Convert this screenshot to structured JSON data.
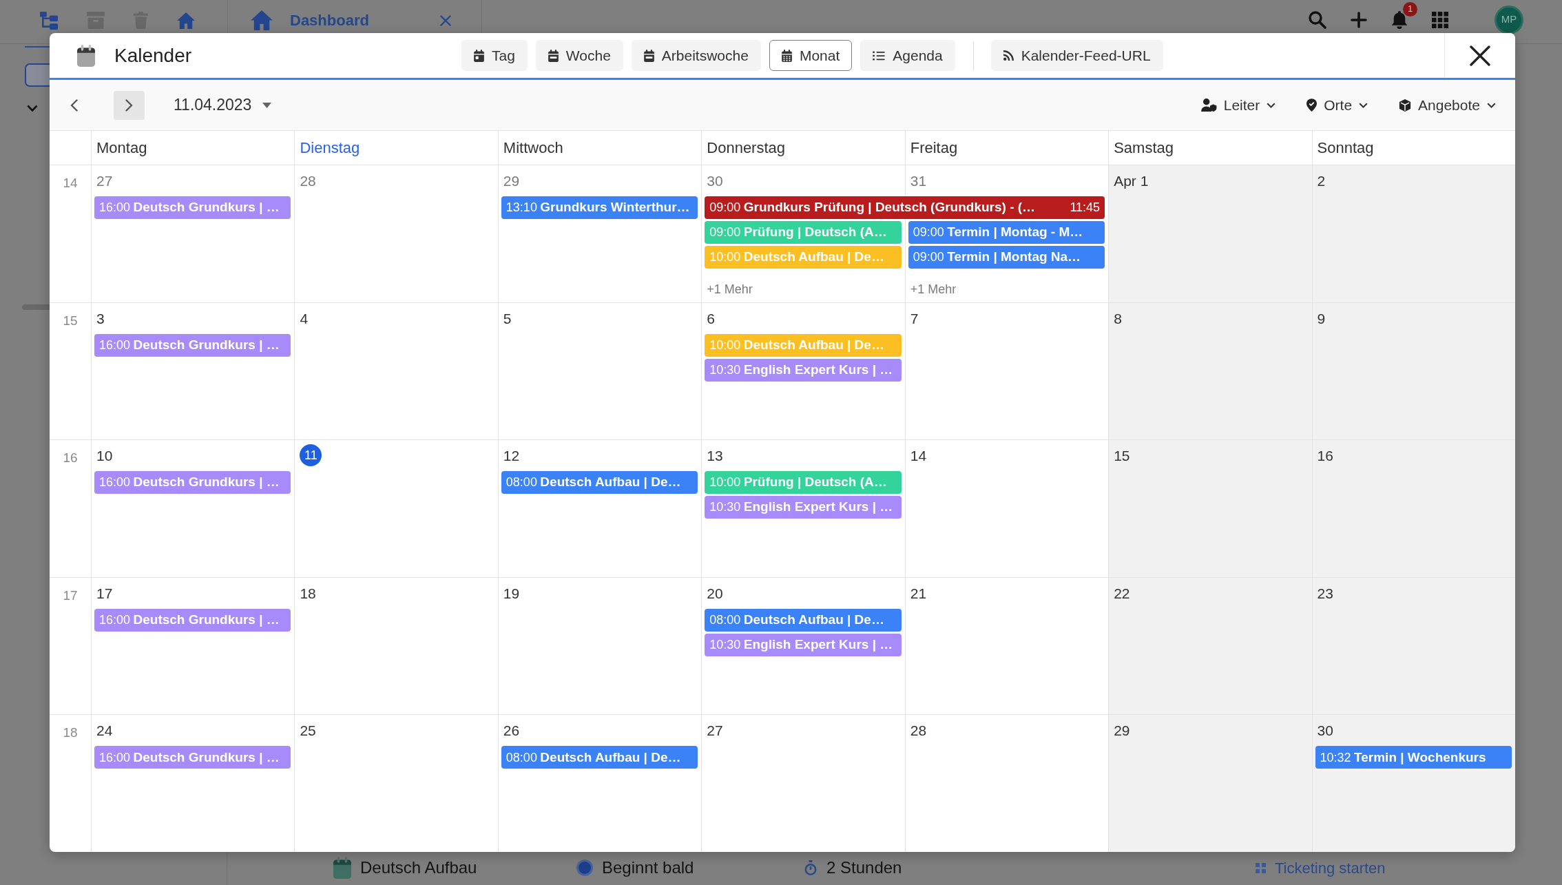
{
  "app": {
    "toolbar": [
      {
        "kind": "hierarchy",
        "disabled": false
      },
      {
        "kind": "archive",
        "disabled": true
      },
      {
        "kind": "trash",
        "disabled": true
      },
      {
        "kind": "home",
        "disabled": false
      }
    ],
    "tab": {
      "label": "Dashboard"
    },
    "notification_count": "1",
    "user_initials": "MP",
    "course_summary": [
      {
        "kind": "course",
        "text": "Deutsch Aufbau"
      },
      {
        "kind": "status",
        "text": "Beginnt bald"
      },
      {
        "kind": "duration",
        "text": "2 Stunden"
      },
      {
        "kind": "action",
        "text": "Ticketing starten"
      }
    ]
  },
  "calendar_dialog": {
    "title": "Kalender",
    "views": [
      {
        "kind": "day",
        "label": "Tag",
        "selected": false
      },
      {
        "kind": "week",
        "label": "Woche",
        "selected": false
      },
      {
        "kind": "workweek",
        "label": "Arbeitswoche",
        "selected": false
      },
      {
        "kind": "month",
        "label": "Monat",
        "selected": true
      },
      {
        "kind": "agenda",
        "label": "Agenda",
        "selected": false
      }
    ],
    "feed_button": "Kalender-Feed-URL",
    "date": "11.04.2023",
    "filters": [
      {
        "kind": "person",
        "label": "Leiter"
      },
      {
        "kind": "place",
        "label": "Orte"
      },
      {
        "kind": "offer",
        "label": "Angebote"
      }
    ],
    "weekdays": [
      {
        "label": "Montag",
        "current": false,
        "weekend": false
      },
      {
        "label": "Dienstag",
        "current": true,
        "weekend": false
      },
      {
        "label": "Mittwoch",
        "current": false,
        "weekend": false
      },
      {
        "label": "Donnerstag",
        "current": false,
        "weekend": false
      },
      {
        "label": "Freitag",
        "current": false,
        "weekend": false
      },
      {
        "label": "Samstag",
        "current": false,
        "weekend": true
      },
      {
        "label": "Sonntag",
        "current": false,
        "weekend": true
      }
    ],
    "weeks": [
      {
        "number": "14",
        "days": [
          {
            "label": "27",
            "other_month": true,
            "today": false,
            "events": [
              {
                "time": "16:00",
                "title": "Deutsch Grundkurs | …",
                "color": "#a78bfa",
                "continues_next_day": false
              }
            ]
          },
          {
            "label": "28",
            "other_month": true,
            "today": false
          },
          {
            "label": "29",
            "other_month": true,
            "today": false,
            "events": [
              {
                "time": "13:10",
                "title": "Grundkurs Winterthur…",
                "color": "#3b82f6",
                "continues_next_day": false
              }
            ]
          },
          {
            "label": "30",
            "other_month": true,
            "today": false,
            "events": [
              {
                "time": "09:00",
                "title": "Grundkurs Prüfung | Deutsch (Grundkurs) - (…",
                "end_time": "11:45",
                "color": "#b91c1c",
                "continues_next_day": true
              },
              {
                "time": "09:00",
                "title": "Prüfung | Deutsch (A…",
                "color": "#34d399",
                "continues_next_day": false
              },
              {
                "time": "10:00",
                "title": "Deutsch Aufbau | De…",
                "color": "#fbbf24",
                "continues_next_day": false
              }
            ],
            "more": "+1 Mehr"
          },
          {
            "label": "31",
            "other_month": true,
            "today": false,
            "events": [
              {
                "time": "09:00",
                "title": "Termin | Montag - M…",
                "color": "#3b82f6",
                "continues_next_day": false
              },
              {
                "time": "09:00",
                "title": "Termin | Montag Na…",
                "color": "#3b82f6",
                "continues_next_day": false
              }
            ],
            "more": "+1 Mehr"
          },
          {
            "label": "Apr 1",
            "other_month": false,
            "today": false
          },
          {
            "label": "2",
            "other_month": false,
            "today": false
          }
        ]
      },
      {
        "number": "15",
        "days": [
          {
            "label": "3",
            "other_month": false,
            "today": false,
            "events": [
              {
                "time": "16:00",
                "title": "Deutsch Grundkurs | …",
                "color": "#a78bfa",
                "continues_next_day": false
              }
            ]
          },
          {
            "label": "4",
            "other_month": false,
            "today": false
          },
          {
            "label": "5",
            "other_month": false,
            "today": false
          },
          {
            "label": "6",
            "other_month": false,
            "today": false,
            "events": [
              {
                "time": "10:00",
                "title": "Deutsch Aufbau | De…",
                "color": "#fbbf24",
                "continues_next_day": false
              },
              {
                "time": "10:30",
                "title": "English Expert Kurs | …",
                "color": "#a78bfa",
                "continues_next_day": false
              }
            ]
          },
          {
            "label": "7",
            "other_month": false,
            "today": false
          },
          {
            "label": "8",
            "other_month": false,
            "today": false
          },
          {
            "label": "9",
            "other_month": false,
            "today": false
          }
        ]
      },
      {
        "number": "16",
        "days": [
          {
            "label": "10",
            "other_month": false,
            "today": false,
            "events": [
              {
                "time": "16:00",
                "title": "Deutsch Grundkurs | …",
                "color": "#a78bfa",
                "continues_next_day": false
              }
            ]
          },
          {
            "label": "11",
            "other_month": false,
            "today": true
          },
          {
            "label": "12",
            "other_month": false,
            "today": false,
            "events": [
              {
                "time": "08:00",
                "title": "Deutsch Aufbau | De…",
                "color": "#3b82f6",
                "continues_next_day": false
              }
            ]
          },
          {
            "label": "13",
            "other_month": false,
            "today": false,
            "events": [
              {
                "time": "10:00",
                "title": "Prüfung | Deutsch (A…",
                "color": "#34d399",
                "continues_next_day": false
              },
              {
                "time": "10:30",
                "title": "English Expert Kurs | …",
                "color": "#a78bfa",
                "continues_next_day": false
              }
            ]
          },
          {
            "label": "14",
            "other_month": false,
            "today": false
          },
          {
            "label": "15",
            "other_month": false,
            "today": false
          },
          {
            "label": "16",
            "other_month": false,
            "today": false
          }
        ]
      },
      {
        "number": "17",
        "days": [
          {
            "label": "17",
            "other_month": false,
            "today": false,
            "events": [
              {
                "time": "16:00",
                "title": "Deutsch Grundkurs | …",
                "color": "#a78bfa",
                "continues_next_day": false
              }
            ]
          },
          {
            "label": "18",
            "other_month": false,
            "today": false
          },
          {
            "label": "19",
            "other_month": false,
            "today": false
          },
          {
            "label": "20",
            "other_month": false,
            "today": false,
            "events": [
              {
                "time": "08:00",
                "title": "Deutsch Aufbau | De…",
                "color": "#3b82f6",
                "continues_next_day": false
              },
              {
                "time": "10:30",
                "title": "English Expert Kurs | …",
                "color": "#a78bfa",
                "continues_next_day": false
              }
            ]
          },
          {
            "label": "21",
            "other_month": false,
            "today": false
          },
          {
            "label": "22",
            "other_month": false,
            "today": false
          },
          {
            "label": "23",
            "other_month": false,
            "today": false
          }
        ]
      },
      {
        "number": "18",
        "days": [
          {
            "label": "24",
            "other_month": false,
            "today": false,
            "events": [
              {
                "time": "16:00",
                "title": "Deutsch Grundkurs | …",
                "color": "#a78bfa",
                "continues_next_day": false
              }
            ]
          },
          {
            "label": "25",
            "other_month": false,
            "today": false
          },
          {
            "label": "26",
            "other_month": false,
            "today": false,
            "events": [
              {
                "time": "08:00",
                "title": "Deutsch Aufbau | De…",
                "color": "#3b82f6",
                "continues_next_day": false
              }
            ]
          },
          {
            "label": "27",
            "other_month": false,
            "today": false
          },
          {
            "label": "28",
            "other_month": false,
            "today": false
          },
          {
            "label": "29",
            "other_month": false,
            "today": false
          },
          {
            "label": "30",
            "other_month": false,
            "today": false,
            "events": [
              {
                "time": "10:32",
                "title": "Termin | Wochenkurs",
                "color": "#3b82f6",
                "continues_next_day": false
              }
            ]
          }
        ]
      }
    ]
  }
}
